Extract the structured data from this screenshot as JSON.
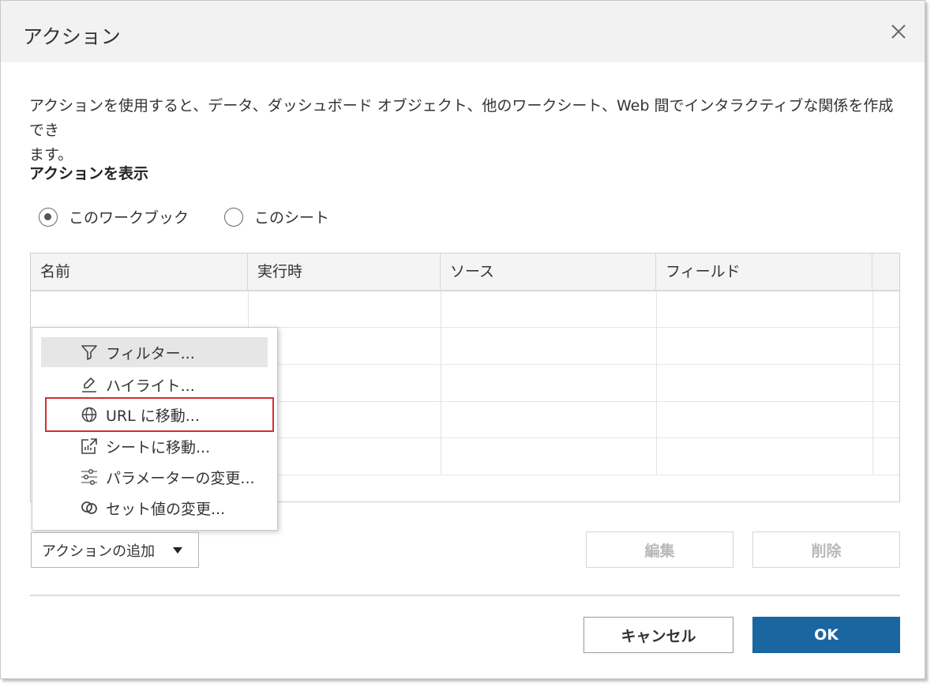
{
  "dialog": {
    "title": "アクション",
    "description_line1": "アクションを使用すると、データ、ダッシュボード オブジェクト、他のワークシート、Web 間でインタラクティブな関係を作成でき",
    "description_line2": "ます。",
    "show_actions_label": "アクションを表示",
    "radio_options": [
      {
        "label": "このワークブック",
        "selected": true
      },
      {
        "label": "このシート",
        "selected": false
      }
    ]
  },
  "table": {
    "columns": [
      "名前",
      "実行時",
      "ソース",
      "フィールド"
    ],
    "rows": []
  },
  "add_menu": {
    "items": [
      {
        "label": "フィルター...",
        "icon": "filter-icon",
        "highlighted": true
      },
      {
        "label": "ハイライト...",
        "icon": "highlighter-icon",
        "highlighted": false
      },
      {
        "label": "URL に移動...",
        "icon": "globe-icon",
        "highlighted": false,
        "outlined": true
      },
      {
        "label": "シートに移動...",
        "icon": "sheet-link-icon",
        "highlighted": false
      },
      {
        "label": "パラメーターの変更...",
        "icon": "sliders-icon",
        "highlighted": false
      },
      {
        "label": "セット値の変更...",
        "icon": "set-rings-icon",
        "highlighted": false
      }
    ],
    "outline_color": "#d32f2f"
  },
  "buttons": {
    "add_action": "アクションの追加",
    "edit": "編集",
    "delete": "削除",
    "cancel": "キャンセル",
    "ok": "OK"
  },
  "colors": {
    "primary": "#1a66a1",
    "titlebar": "#f2f2f2",
    "disabled_text": "#b8b8b8"
  }
}
